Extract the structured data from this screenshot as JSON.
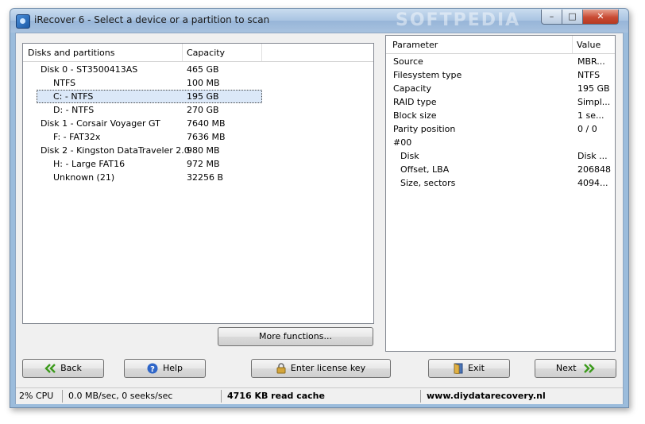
{
  "window": {
    "title": "iRecover 6 - Select a device or a partition to scan",
    "watermark": "SOFTPEDIA",
    "controls": {
      "minimize": "–",
      "maximize": "□",
      "close": "✕"
    }
  },
  "disks": {
    "columns": [
      "Disks and partitions",
      "Capacity"
    ],
    "rows": [
      {
        "name": "Disk 0 - ST3500413AS",
        "capacity": "465 GB",
        "level": 0
      },
      {
        "name": "NTFS",
        "capacity": "100 MB",
        "level": 1
      },
      {
        "name": "C: - NTFS",
        "capacity": "195 GB",
        "level": 1,
        "selected": true
      },
      {
        "name": "D: - NTFS",
        "capacity": "270 GB",
        "level": 1
      },
      {
        "name": "Disk 1 - Corsair Voyager GT",
        "capacity": "7640 MB",
        "level": 0
      },
      {
        "name": "F: - FAT32x",
        "capacity": "7636 MB",
        "level": 1
      },
      {
        "name": "Disk 2 - Kingston DataTraveler 2.0",
        "capacity": "980 MB",
        "level": 0
      },
      {
        "name": "H: - Large FAT16",
        "capacity": "972 MB",
        "level": 1
      },
      {
        "name": "Unknown (21)",
        "capacity": "32256 B",
        "level": 1
      }
    ]
  },
  "params": {
    "columns": [
      "Parameter",
      "Value"
    ],
    "rows": [
      {
        "name": "Source",
        "value": "MBR...",
        "level": 0
      },
      {
        "name": "Filesystem type",
        "value": "NTFS",
        "level": 0
      },
      {
        "name": "Capacity",
        "value": "195 GB",
        "level": 0
      },
      {
        "name": "RAID type",
        "value": "Simpl...",
        "level": 0
      },
      {
        "name": "Block size",
        "value": "1 se...",
        "level": 0
      },
      {
        "name": "Parity position",
        "value": "0 / 0",
        "level": 0
      },
      {
        "name": "#00",
        "value": "",
        "level": 0
      },
      {
        "name": "Disk",
        "value": "Disk ...",
        "level": 1
      },
      {
        "name": "Offset, LBA",
        "value": "206848",
        "level": 1
      },
      {
        "name": "Size, sectors",
        "value": "4094...",
        "level": 1
      }
    ]
  },
  "buttons": {
    "more_functions": "More functions...",
    "back": "Back",
    "help": "Help",
    "license": "Enter license key",
    "exit": "Exit",
    "next": "Next"
  },
  "status": {
    "cpu": "2% CPU",
    "io": "0.0 MB/sec, 0 seeks/sec",
    "cache": "4716 KB read cache",
    "url": "www.diydatarecovery.nl"
  },
  "colors": {
    "accent_green": "#3c9a1c",
    "help_blue": "#2f66c8",
    "selection_bg": "#dbe8f8"
  }
}
